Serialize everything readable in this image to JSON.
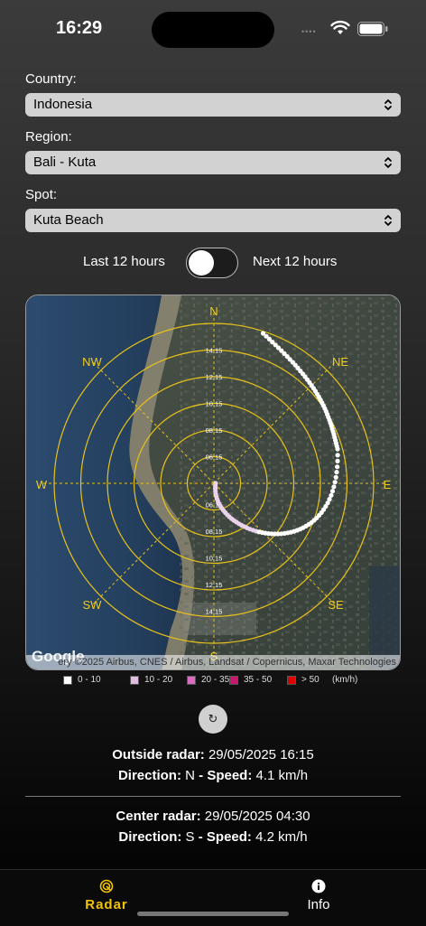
{
  "status": {
    "time": "16:29"
  },
  "form": {
    "country_label": "Country:",
    "country_value": "Indonesia",
    "region_label": "Region:",
    "region_value": "Bali - Kuta",
    "spot_label": "Spot:",
    "spot_value": "Kuta Beach"
  },
  "toggle": {
    "left_label": "Last 12 hours",
    "right_label": "Next 12 hours",
    "state": "off"
  },
  "radar": {
    "directions": {
      "n": "N",
      "ne": "NE",
      "e": "E",
      "se": "SE",
      "s": "S",
      "sw": "SW",
      "w": "W",
      "nw": "NW"
    },
    "north_times": [
      "14:15",
      "12:15",
      "10:15",
      "08:15",
      "06:15"
    ],
    "south_times": [
      "06:15",
      "08:15",
      "10:15",
      "12:15",
      "14:15"
    ],
    "attribution": "ery ©2025 Airbus, CNES / Airbus, Landsat / Copernicus, Maxar Technologies",
    "map_logo": "Google",
    "ring_color": "#e8c21a"
  },
  "legend": {
    "items": [
      {
        "label": "0 - 10",
        "color": "#ffffff"
      },
      {
        "label": "10 - 20",
        "color": "#e3bde0"
      },
      {
        "label": "20 - 35",
        "color": "#d96bc1"
      },
      {
        "label": "35 - 50",
        "color": "#c8186d"
      },
      {
        "label": "> 50",
        "color": "#e00000"
      }
    ],
    "unit": "(km/h)"
  },
  "outside": {
    "label": "Outside radar:",
    "datetime": "29/05/2025 16:15",
    "direction_label": "Direction:",
    "direction": "N",
    "speed_label": "- Speed:",
    "speed": "4.1 km/h"
  },
  "center": {
    "label": "Center radar:",
    "datetime": "29/05/2025 04:30",
    "direction_label": "Direction:",
    "direction": "S",
    "speed_label": "- Speed:",
    "speed": "4.2 km/h"
  },
  "tabs": [
    {
      "label": "Radar",
      "icon": "radar-icon",
      "active": true
    },
    {
      "label": "Info",
      "icon": "info-icon",
      "active": false
    }
  ]
}
